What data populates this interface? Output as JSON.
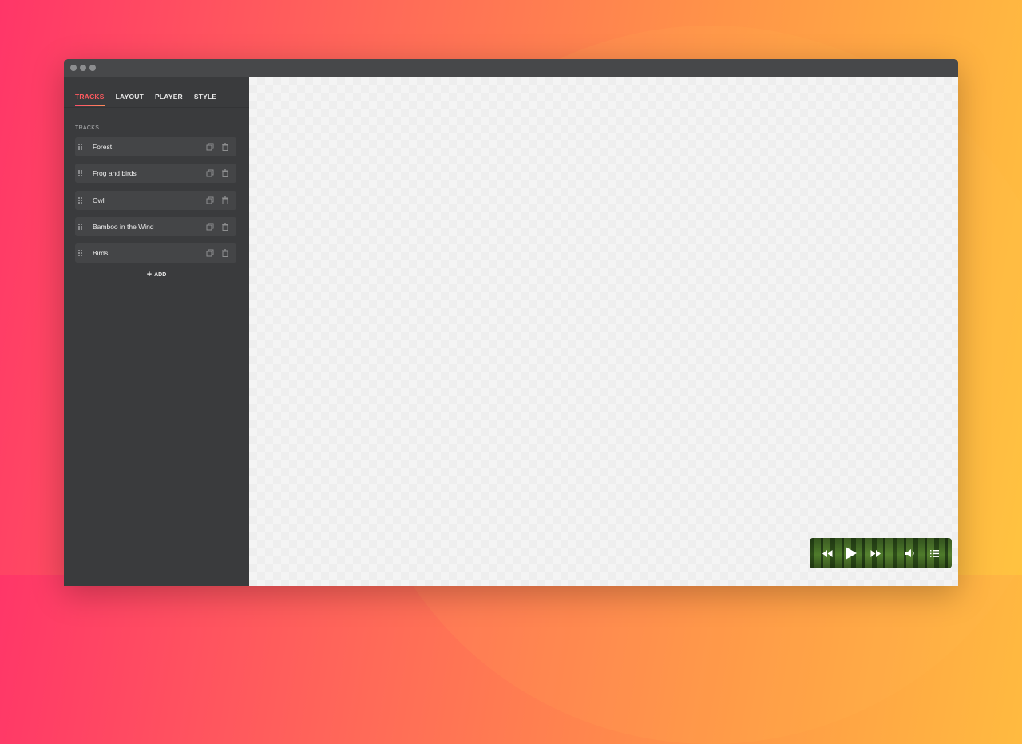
{
  "window": {
    "traffic_lights": [
      "close",
      "minimize",
      "maximize"
    ]
  },
  "sidebar": {
    "tabs": [
      {
        "label": "TRACKS",
        "active": true
      },
      {
        "label": "LAYOUT",
        "active": false
      },
      {
        "label": "PLAYER",
        "active": false
      },
      {
        "label": "STYLE",
        "active": false
      }
    ],
    "section_label": "TRACKS",
    "tracks": [
      {
        "name": "Forest"
      },
      {
        "name": "Frog and birds"
      },
      {
        "name": "Owl"
      },
      {
        "name": "Bamboo in the Wind"
      },
      {
        "name": "Birds"
      }
    ],
    "track_icons": {
      "drag": "drag-handle-icon",
      "duplicate": "duplicate-icon",
      "delete": "trash-icon"
    },
    "add_label": "ADD"
  },
  "player": {
    "controls": [
      "rewind-icon",
      "play-icon",
      "fast-forward-icon",
      "volume-icon",
      "playlist-icon"
    ]
  },
  "colors": {
    "accent": "#ff5a5f",
    "sidebar_bg": "#3a3b3d",
    "titlebar_bg": "#47484a",
    "canvas_bg": "#f4f4f4"
  }
}
